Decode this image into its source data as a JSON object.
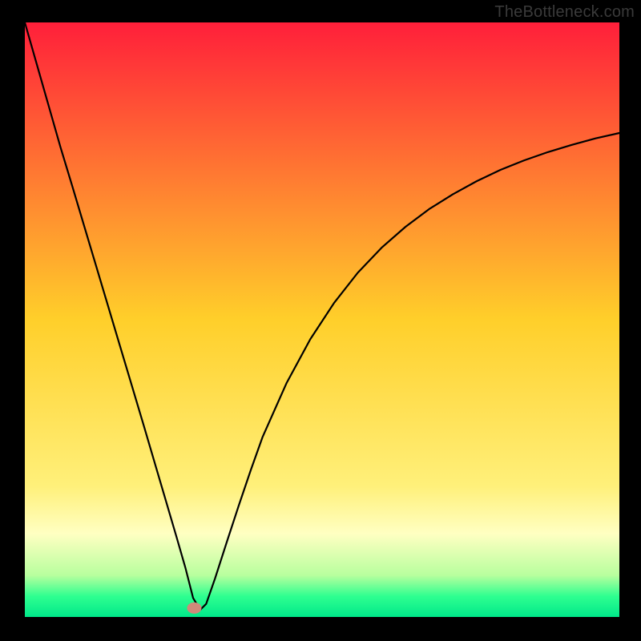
{
  "watermark": {
    "text": "TheBottleneck.com"
  },
  "chart_data": {
    "type": "line",
    "title": "",
    "xlabel": "",
    "ylabel": "",
    "xlim": [
      0,
      100
    ],
    "ylim": [
      0,
      100
    ],
    "grid": false,
    "legend": false,
    "background_gradient": {
      "stops": [
        {
          "pos": 0.0,
          "color": "#ff1f3a"
        },
        {
          "pos": 0.5,
          "color": "#ffcf2a"
        },
        {
          "pos": 0.78,
          "color": "#fff07a"
        },
        {
          "pos": 0.86,
          "color": "#ffffc2"
        },
        {
          "pos": 0.93,
          "color": "#b8ff9e"
        },
        {
          "pos": 0.965,
          "color": "#2fff90"
        },
        {
          "pos": 1.0,
          "color": "#00e88a"
        }
      ]
    },
    "marker": {
      "x": 28.5,
      "y": 1.5,
      "color": "#cf8a7a"
    },
    "series": [
      {
        "name": "curve",
        "x": [
          0,
          2,
          4,
          6,
          8,
          10,
          12,
          14,
          16,
          18,
          20,
          22,
          24,
          25.5,
          27,
          28.3,
          29.5,
          30.5,
          32,
          34,
          36,
          38,
          40,
          44,
          48,
          52,
          56,
          60,
          64,
          68,
          72,
          76,
          80,
          84,
          88,
          92,
          96,
          100
        ],
        "y": [
          100,
          93,
          86,
          79,
          72.4,
          65.7,
          59,
          52.3,
          45.6,
          38.9,
          32.2,
          25.4,
          18.6,
          13.5,
          8.3,
          3.2,
          1.2,
          2.2,
          6.5,
          12.7,
          18.8,
          24.7,
          30.3,
          39.3,
          46.7,
          52.8,
          57.9,
          62.1,
          65.6,
          68.6,
          71.1,
          73.3,
          75.2,
          76.8,
          78.2,
          79.4,
          80.5,
          81.4
        ]
      }
    ]
  },
  "layout": {
    "outer": 800,
    "inner_left": 31,
    "inner_top": 28,
    "inner_width": 742,
    "inner_height": 742
  }
}
